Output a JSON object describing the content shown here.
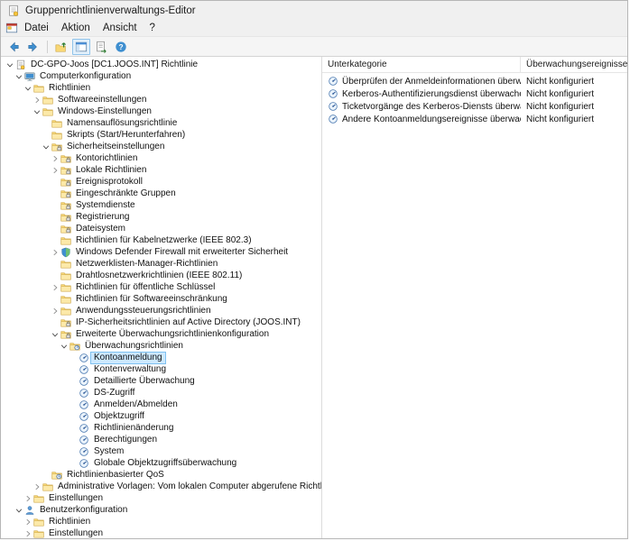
{
  "window": {
    "title": "Gruppenrichtlinienverwaltungs-Editor"
  },
  "menu": {
    "items": [
      "Datei",
      "Aktion",
      "Ansicht",
      "?"
    ]
  },
  "toolbar": {
    "buttons": [
      {
        "name": "back",
        "pressed": false
      },
      {
        "name": "forward",
        "pressed": false
      },
      {
        "name": "up-one-level",
        "pressed": false
      },
      {
        "name": "show-console-tree",
        "pressed": true
      },
      {
        "name": "export-list",
        "pressed": false
      },
      {
        "name": "help",
        "pressed": false
      }
    ]
  },
  "colors": {
    "selection_bg": "#cce8ff",
    "selection_border": "#7fc1f0",
    "accent": "#3f8fd0",
    "folder": "#f8d775"
  },
  "tree": {
    "items": [
      {
        "label": "DC-GPO-Joos [DC1.JOOS.INT] Richtlinie",
        "level": 0,
        "expand": "open",
        "icon": "policy",
        "selected": false
      },
      {
        "label": "Computerkonfiguration",
        "level": 1,
        "expand": "open",
        "icon": "computer",
        "selected": false
      },
      {
        "label": "Richtlinien",
        "level": 2,
        "expand": "open",
        "icon": "folder",
        "selected": false
      },
      {
        "label": "Softwareeinstellungen",
        "level": 3,
        "expand": "closed",
        "icon": "folder",
        "selected": false
      },
      {
        "label": "Windows-Einstellungen",
        "level": 3,
        "expand": "open",
        "icon": "folder",
        "selected": false
      },
      {
        "label": "Namensauflösungsrichtlinie",
        "level": 4,
        "expand": "none",
        "icon": "folder",
        "selected": false
      },
      {
        "label": "Skripts (Start/Herunterfahren)",
        "level": 4,
        "expand": "none",
        "icon": "folder",
        "selected": false
      },
      {
        "label": "Sicherheitseinstellungen",
        "level": 4,
        "expand": "open",
        "icon": "folder-lock",
        "selected": false
      },
      {
        "label": "Kontorichtlinien",
        "level": 5,
        "expand": "closed",
        "icon": "folder-lock",
        "selected": false
      },
      {
        "label": "Lokale Richtlinien",
        "level": 5,
        "expand": "closed",
        "icon": "folder-lock",
        "selected": false
      },
      {
        "label": "Ereignisprotokoll",
        "level": 5,
        "expand": "none",
        "icon": "folder-lock",
        "selected": false
      },
      {
        "label": "Eingeschränkte Gruppen",
        "level": 5,
        "expand": "none",
        "icon": "folder-lock",
        "selected": false
      },
      {
        "label": "Systemdienste",
        "level": 5,
        "expand": "none",
        "icon": "folder-lock",
        "selected": false
      },
      {
        "label": "Registrierung",
        "level": 5,
        "expand": "none",
        "icon": "folder-lock",
        "selected": false
      },
      {
        "label": "Dateisystem",
        "level": 5,
        "expand": "none",
        "icon": "folder-lock",
        "selected": false
      },
      {
        "label": "Richtlinien für Kabelnetzwerke (IEEE 802.3)",
        "level": 5,
        "expand": "none",
        "icon": "folder",
        "selected": false
      },
      {
        "label": "Windows Defender Firewall mit erweiterter Sicherheit",
        "level": 5,
        "expand": "closed",
        "icon": "shield",
        "selected": false
      },
      {
        "label": "Netzwerklisten-Manager-Richtlinien",
        "level": 5,
        "expand": "none",
        "icon": "folder",
        "selected": false
      },
      {
        "label": "Drahtlosnetzwerkrichtlinien (IEEE 802.11)",
        "level": 5,
        "expand": "none",
        "icon": "folder",
        "selected": false
      },
      {
        "label": "Richtlinien für öffentliche Schlüssel",
        "level": 5,
        "expand": "closed",
        "icon": "folder",
        "selected": false
      },
      {
        "label": "Richtlinien für Softwareeinschränkung",
        "level": 5,
        "expand": "none",
        "icon": "folder",
        "selected": false
      },
      {
        "label": "Anwendungssteuerungsrichtlinien",
        "level": 5,
        "expand": "closed",
        "icon": "folder",
        "selected": false
      },
      {
        "label": "IP-Sicherheitsrichtlinien auf Active Directory (JOOS.INT)",
        "level": 5,
        "expand": "none",
        "icon": "folder-lock",
        "selected": false
      },
      {
        "label": "Erweiterte Überwachungsrichtlinienkonfiguration",
        "level": 5,
        "expand": "open",
        "icon": "folder-lock",
        "selected": false
      },
      {
        "label": "Überwachungsrichtlinien",
        "level": 6,
        "expand": "open",
        "icon": "audit-folder",
        "selected": false
      },
      {
        "label": "Kontoanmeldung",
        "level": 7,
        "expand": "none",
        "icon": "audit",
        "selected": true
      },
      {
        "label": "Kontenverwaltung",
        "level": 7,
        "expand": "none",
        "icon": "audit",
        "selected": false
      },
      {
        "label": "Detaillierte Überwachung",
        "level": 7,
        "expand": "none",
        "icon": "audit",
        "selected": false
      },
      {
        "label": "DS-Zugriff",
        "level": 7,
        "expand": "none",
        "icon": "audit",
        "selected": false
      },
      {
        "label": "Anmelden/Abmelden",
        "level": 7,
        "expand": "none",
        "icon": "audit",
        "selected": false
      },
      {
        "label": "Objektzugriff",
        "level": 7,
        "expand": "none",
        "icon": "audit",
        "selected": false
      },
      {
        "label": "Richtlinienänderung",
        "level": 7,
        "expand": "none",
        "icon": "audit",
        "selected": false
      },
      {
        "label": "Berechtigungen",
        "level": 7,
        "expand": "none",
        "icon": "audit",
        "selected": false
      },
      {
        "label": "System",
        "level": 7,
        "expand": "none",
        "icon": "audit",
        "selected": false
      },
      {
        "label": "Globale Objektzugriffsüberwachung",
        "level": 7,
        "expand": "none",
        "icon": "audit",
        "selected": false
      },
      {
        "label": "Richtlinienbasierter QoS",
        "level": 4,
        "expand": "none",
        "icon": "qos",
        "selected": false
      },
      {
        "label": "Administrative Vorlagen: Vom lokalen Computer abgerufene Richtliniendefir",
        "level": 3,
        "expand": "closed",
        "icon": "folder",
        "selected": false
      },
      {
        "label": "Einstellungen",
        "level": 2,
        "expand": "closed",
        "icon": "folder",
        "selected": false
      },
      {
        "label": "Benutzerkonfiguration",
        "level": 1,
        "expand": "open",
        "icon": "user",
        "selected": false
      },
      {
        "label": "Richtlinien",
        "level": 2,
        "expand": "closed",
        "icon": "folder",
        "selected": false
      },
      {
        "label": "Einstellungen",
        "level": 2,
        "expand": "closed",
        "icon": "folder",
        "selected": false
      }
    ]
  },
  "details": {
    "columns": [
      "Unterkategorie",
      "Überwachungsereignisse"
    ],
    "rows": [
      {
        "name": "Überprüfen der Anmeldeinformationen überwachen",
        "value": "Nicht konfiguriert"
      },
      {
        "name": "Kerberos-Authentifizierungsdienst überwachen",
        "value": "Nicht konfiguriert"
      },
      {
        "name": "Ticketvorgänge des Kerberos-Diensts überwachen",
        "value": "Nicht konfiguriert"
      },
      {
        "name": "Andere Kontoanmeldungsereignisse überwachen",
        "value": "Nicht konfiguriert"
      }
    ]
  }
}
